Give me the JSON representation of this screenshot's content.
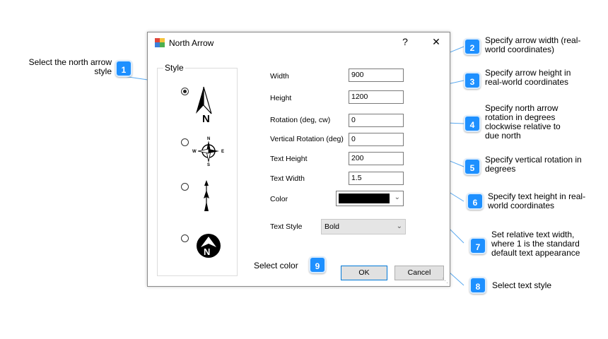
{
  "dialog": {
    "title": "North Arrow",
    "help_button": "?",
    "close_button": "✕"
  },
  "style_group": {
    "label": "Style",
    "options": [
      {
        "name": "simple-north-arrow",
        "selected": true
      },
      {
        "name": "compass-rose",
        "selected": false
      },
      {
        "name": "thin-arrow",
        "selected": false
      },
      {
        "name": "circle-north-arrow",
        "selected": false
      }
    ],
    "compass_letters": {
      "n": "N",
      "s": "S",
      "e": "E",
      "w": "W"
    },
    "arrow_letter": "N"
  },
  "fields": {
    "width": {
      "label": "Width",
      "value": "900"
    },
    "height": {
      "label": "Height",
      "value": "1200"
    },
    "rotation": {
      "label": "Rotation (deg, cw)",
      "value": "0"
    },
    "vertical_rotation": {
      "label": "Vertical Rotation (deg)",
      "value": "0"
    },
    "text_height": {
      "label": "Text Height",
      "value": "200"
    },
    "text_width": {
      "label": "Text Width",
      "value": "1.5"
    },
    "color": {
      "label": "Color",
      "value": "#000000"
    },
    "text_style": {
      "label": "Text Style",
      "value": "Bold"
    }
  },
  "buttons": {
    "ok": "OK",
    "cancel": "Cancel"
  },
  "callouts": [
    {
      "number": "1",
      "text": "Select the north arrow style"
    },
    {
      "number": "2",
      "text": "Specify arrow width (real-world coordinates)"
    },
    {
      "number": "3",
      "text": "Specify arrow height in real-world coordinates"
    },
    {
      "number": "4",
      "text": "Specify north arrow rotation in degrees clockwise relative to due north"
    },
    {
      "number": "5",
      "text": "Specify vertical rotation in degrees"
    },
    {
      "number": "6",
      "text": "Specify text height in real-world coordinates"
    },
    {
      "number": "7",
      "text": "Set relative text width, where 1 is the standard default text appearance"
    },
    {
      "number": "8",
      "text": "Select text style"
    },
    {
      "number": "9",
      "text": "Select color"
    }
  ],
  "colors": {
    "badge": "#1e90ff",
    "connector": "#5aa9f0",
    "swatch": "#000000"
  }
}
